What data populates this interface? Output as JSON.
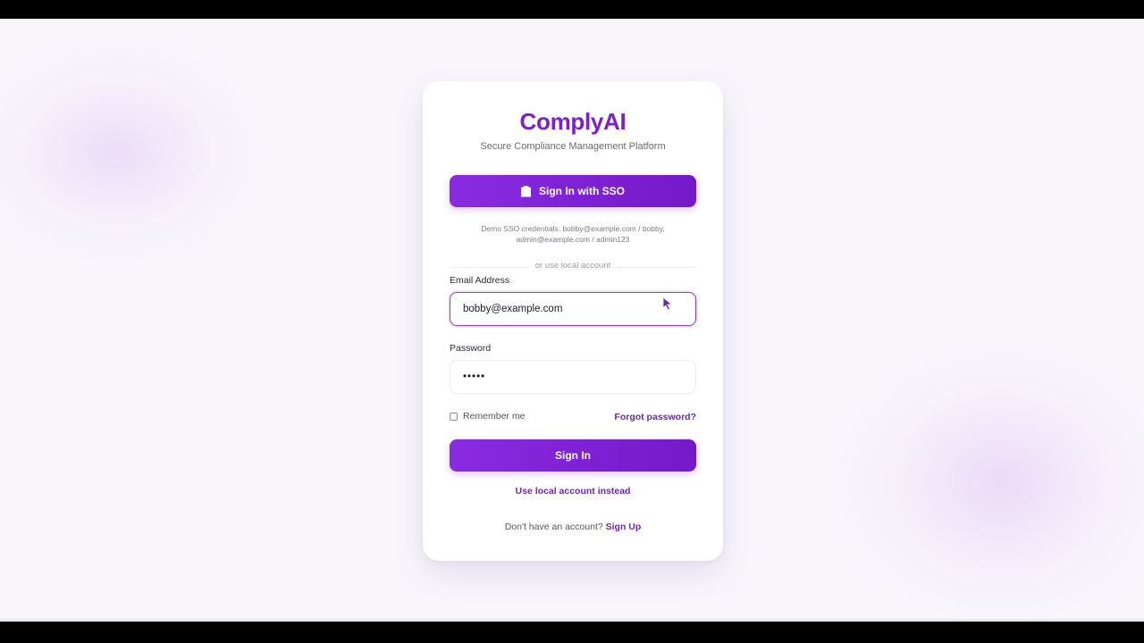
{
  "brand": {
    "name": "ComplyAI",
    "tagline": "Secure Compliance Management Platform"
  },
  "sso": {
    "button_label": "Sign In with SSO",
    "icon": "shield-icon",
    "demo_line1": "Demo SSO credentials: bobby@example.com / bobby,",
    "demo_line2": "admin@example.com / admin123"
  },
  "divider": {
    "text": "or use local account"
  },
  "form": {
    "email_label": "Email Address",
    "email_value": "bobby@example.com",
    "password_label": "Password",
    "password_value": "•••••",
    "remember_label": "Remember me",
    "remember_checked": false,
    "forgot_label": "Forgot password?",
    "submit_label": "Sign In",
    "local_link_label": "Use local account instead"
  },
  "signup": {
    "prompt": "Don't have an account?",
    "link_label": "Sign Up"
  },
  "colors": {
    "accent": "#7b1fd0",
    "button_start": "#8a2be2",
    "button_end": "#7419c9",
    "link": "#6d2aa8",
    "background": "#f8f6fb"
  }
}
